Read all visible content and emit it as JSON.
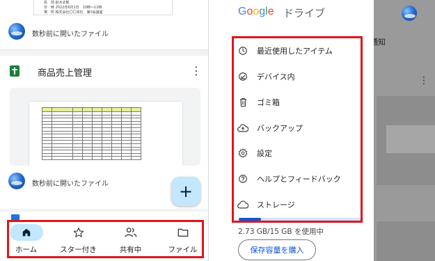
{
  "left": {
    "top_card": {
      "doc_lines": [
        "名　前  鈴木太郎",
        "日　時  2022年6月1日　10時～12時",
        "場　所  株式会社〇〇本社　第3会議室"
      ],
      "meta": "数秒前に開いたファイル"
    },
    "main_card": {
      "title": "商品売上管理",
      "meta": "数秒前に開いたファイル"
    },
    "fab_label": "+",
    "bottom_nav": {
      "items": [
        {
          "label": "ホーム",
          "icon": "home-icon",
          "active": true
        },
        {
          "label": "スター付き",
          "icon": "star-icon",
          "active": false
        },
        {
          "label": "共有中",
          "icon": "people-icon",
          "active": false
        },
        {
          "label": "ファイル",
          "icon": "folder-icon",
          "active": false
        }
      ]
    }
  },
  "right": {
    "logo": {
      "letters": [
        {
          "ch": "G",
          "color": "#4285F4"
        },
        {
          "ch": "o",
          "color": "#EA4335"
        },
        {
          "ch": "o",
          "color": "#FBBC05"
        },
        {
          "ch": "g",
          "color": "#4285F4"
        },
        {
          "ch": "l",
          "color": "#34A853"
        },
        {
          "ch": "e",
          "color": "#EA4335"
        }
      ],
      "suffix": "ドライブ"
    },
    "background_label": "通知",
    "menu": [
      {
        "label": "最近使用したアイテム",
        "icon": "clock-icon"
      },
      {
        "label": "デバイス内",
        "icon": "device-check-icon"
      },
      {
        "label": "ゴミ箱",
        "icon": "trash-icon"
      },
      {
        "label": "バックアップ",
        "icon": "cloud-upload-icon"
      },
      {
        "label": "設定",
        "icon": "gear-icon"
      },
      {
        "label": "ヘルプとフィードバック",
        "icon": "help-icon"
      },
      {
        "label": "ストレージ",
        "icon": "cloud-icon"
      }
    ],
    "storage": {
      "text": "2.73 GB/15 GB を使用中",
      "used_fraction": 0.18
    },
    "buy_button": "保存容量を購入"
  },
  "colors": {
    "accent": "#c2e7ff",
    "highlight_box": "#e0151b",
    "sheets_green": "#188038",
    "storage_fill": "#0b57d0"
  }
}
